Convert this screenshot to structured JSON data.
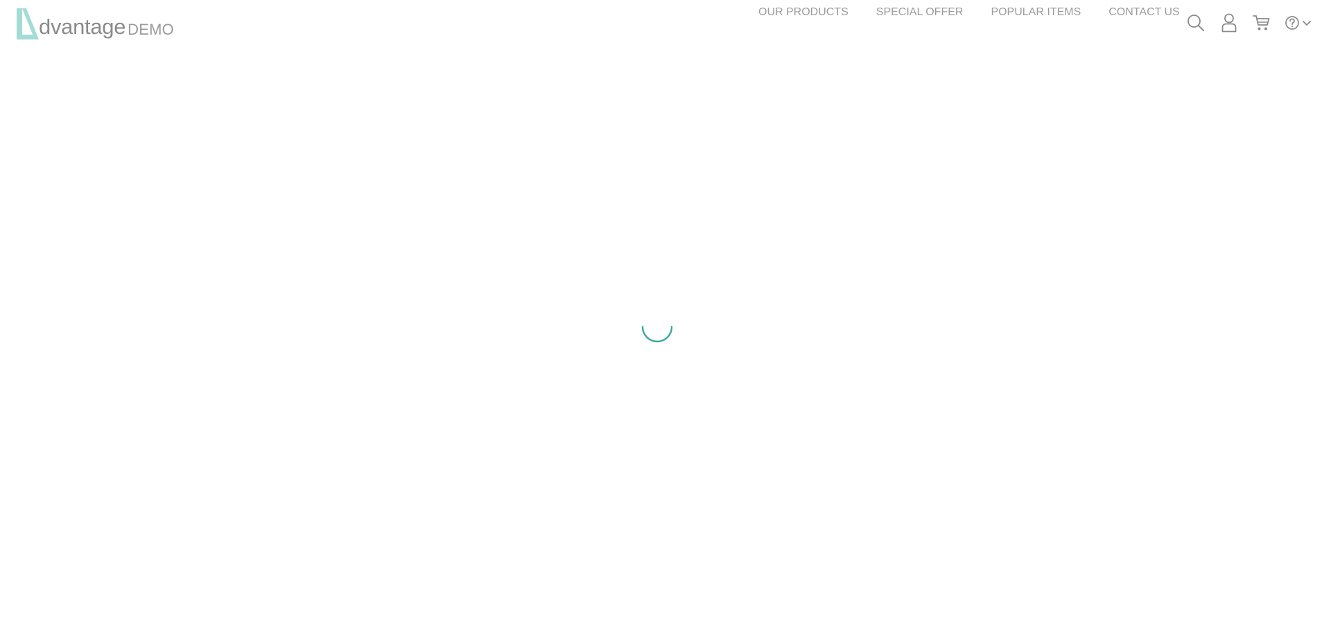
{
  "brand": {
    "name": "dvantage",
    "suffix": "DEMO",
    "accent": "#a3dcd6"
  },
  "nav": {
    "items": [
      {
        "label": "OUR PRODUCTS"
      },
      {
        "label": "SPECIAL OFFER"
      },
      {
        "label": "POPULAR ITEMS"
      },
      {
        "label": "CONTACT US"
      }
    ]
  },
  "icons": {
    "search": "search-icon",
    "user": "user-icon",
    "cart": "cart-icon",
    "help": "help-icon",
    "dropdown": "chevron-down-icon"
  },
  "loader": {
    "color": "#3ba69e"
  }
}
